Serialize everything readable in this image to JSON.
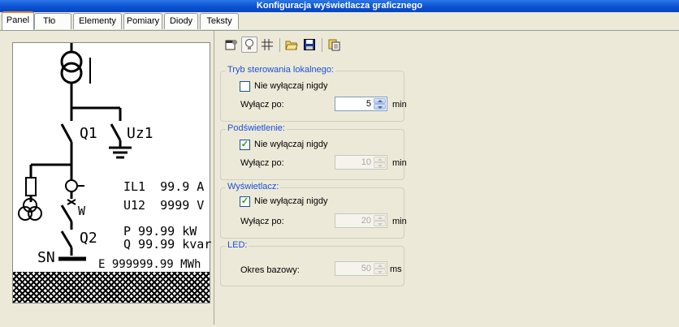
{
  "window": {
    "title": "Konfiguracja wyświetlacza graficznego"
  },
  "tabs": [
    {
      "label": "Panel",
      "active": true
    },
    {
      "label": "Tło"
    },
    {
      "label": "Elementy"
    },
    {
      "label": "Pomiary"
    },
    {
      "label": "Diody"
    },
    {
      "label": "Teksty"
    }
  ],
  "toolbar": {
    "icons": [
      "properties-icon",
      "bulb-icon",
      "grid-icon",
      "open-folder-icon",
      "save-icon",
      "copy-icon"
    ],
    "pressed": "bulb-icon"
  },
  "display": {
    "labels": {
      "q1": "Q1",
      "uz1": "Uz1",
      "w": "W",
      "q2": "Q2",
      "sn": "SN"
    },
    "measurements": {
      "il1": "IL1  99.9 A",
      "u12": "U12  9999 V",
      "p": "P 99.99 kW",
      "q": "Q 99.99 kvar",
      "e": "E 999999.99 MWh"
    }
  },
  "groups": {
    "local_control": {
      "title": "Tryb sterowania lokalnego:",
      "checkbox_label": "Nie wyłączaj nigdy",
      "checked": false,
      "off_after_label": "Wyłącz po:",
      "value": "5",
      "unit": "min",
      "enabled": true
    },
    "backlight": {
      "title": "Podświetlenie:",
      "checkbox_label": "Nie wyłączaj nigdy",
      "checked": true,
      "off_after_label": "Wyłącz po:",
      "value": "10",
      "unit": "min",
      "enabled": false
    },
    "display": {
      "title": "Wyświetlacz:",
      "checkbox_label": "Nie wyłączaj nigdy",
      "checked": true,
      "off_after_label": "Wyłącz po:",
      "value": "20",
      "unit": "min",
      "enabled": false
    },
    "led": {
      "title": "LED:",
      "period_label": "Okres bazowy:",
      "value": "50",
      "unit": "ms",
      "enabled": false
    }
  },
  "colors": {
    "title_bar": "#0a4fd0",
    "group_title": "#1b4fd8",
    "checkmark": "#21a121",
    "active_tab_accent": "#e68b2c"
  }
}
